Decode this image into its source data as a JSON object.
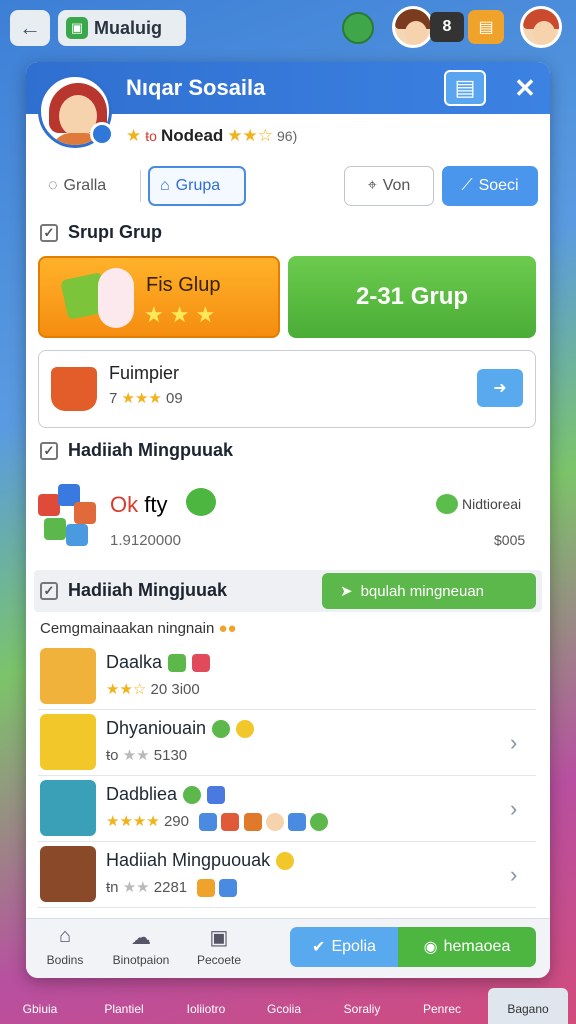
{
  "topbar": {
    "back_icon": "arrow-left-icon",
    "title": "Mualuig",
    "count": "8"
  },
  "panel": {
    "name": "Nıqar Sosaila",
    "rating_prefix": "ŧo",
    "rating_title": "Nodead",
    "rating_stars": "★★☆",
    "rating_value": "96)"
  },
  "tabs": [
    {
      "label": "Gralla"
    },
    {
      "label": "Grupa"
    },
    {
      "label": "Von"
    },
    {
      "label": "Soeci"
    }
  ],
  "group_section": {
    "heading": "Srupı Grup",
    "orange_card_label": "Fis Glup",
    "orange_card_stars": "★★★",
    "green_card_label": "2-31 Grup"
  },
  "item": {
    "name": "Fuimpier",
    "meta_count": "7",
    "meta_stars": "★★★",
    "meta_value": "09"
  },
  "reward_section": {
    "heading": "Hadiiah Mingpuuak",
    "value_red": "Ok",
    "value_rest": "fty",
    "number": "1.9120000",
    "right_label": "Nidtioreai",
    "right_price": "$005"
  },
  "claim_section": {
    "heading": "Hadiiah Mingjuuak",
    "button_label": "bqulah mingneuan"
  },
  "list": {
    "caption": "Cemgmainaakan ningnain",
    "rows": [
      {
        "name": "Daalka",
        "sub_stars": "★★☆",
        "sub_text": "20 3i00"
      },
      {
        "name": "Dhyaniouain",
        "sub_stars": "★★",
        "sub_text": "5130",
        "sub_prefix": "ŧo"
      },
      {
        "name": "Dadbliea",
        "sub_stars": "★★★★",
        "sub_text": "290"
      },
      {
        "name": "Hadiiah Mingpuouak",
        "sub_stars": "★★",
        "sub_text": "2281",
        "sub_prefix": "ŧn"
      }
    ]
  },
  "bottom_bar": {
    "items": [
      {
        "label": "Bodins"
      },
      {
        "label": "Binotpaion"
      },
      {
        "label": "Pecoete"
      }
    ],
    "btn1_label": "Epolia",
    "btn2_label": "hemaoea"
  },
  "footer": {
    "items": [
      {
        "label": "Gbiuia"
      },
      {
        "label": "Plantiel"
      },
      {
        "label": "Ioliiotro"
      },
      {
        "label": "Gcoiia"
      },
      {
        "label": "Soraliy"
      },
      {
        "label": "Penrec"
      },
      {
        "label": "Bagano"
      }
    ]
  }
}
